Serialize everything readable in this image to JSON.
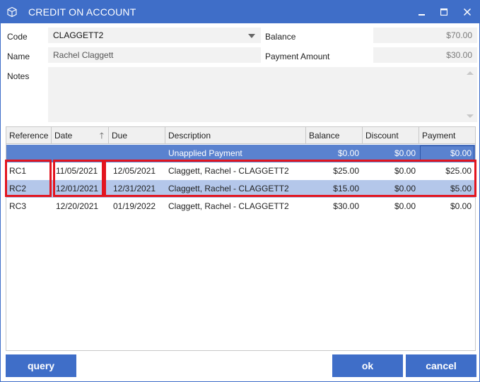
{
  "window": {
    "title": "CREDIT ON ACCOUNT",
    "controls": {
      "minimize": "▁",
      "maximize": "□",
      "close": "✕"
    }
  },
  "form": {
    "code_label": "Code",
    "code_value": "CLAGGETT2",
    "name_label": "Name",
    "name_value": "Rachel Claggett",
    "notes_label": "Notes",
    "notes_value": "",
    "balance_label": "Balance",
    "balance_value": "$70.00",
    "payment_amount_label": "Payment Amount",
    "payment_amount_value": "$30.00"
  },
  "grid": {
    "columns": [
      "Reference",
      "Date",
      "Due",
      "Description",
      "Balance",
      "Discount",
      "Payment"
    ],
    "sorted_column": "Date",
    "sort_direction": "ascending",
    "summary": {
      "description": "Unapplied Payment",
      "balance": "$0.00",
      "discount": "$0.00",
      "payment": "$0.00"
    },
    "rows": [
      {
        "reference": "RC1",
        "date": "11/05/2021",
        "due": "12/05/2021",
        "description": "Claggett, Rachel - CLAGGETT2",
        "balance": "$25.00",
        "discount": "$0.00",
        "payment": "$25.00"
      },
      {
        "reference": "RC2",
        "date": "12/01/2021",
        "due": "12/31/2021",
        "description": "Claggett, Rachel - CLAGGETT2",
        "balance": "$15.00",
        "discount": "$0.00",
        "payment": "$5.00"
      },
      {
        "reference": "RC3",
        "date": "12/20/2021",
        "due": "01/19/2022",
        "description": "Claggett, Rachel - CLAGGETT2",
        "balance": "$30.00",
        "discount": "$0.00",
        "payment": "$0.00"
      }
    ],
    "selected_row_index": 1,
    "highlight_color": "#e3151f"
  },
  "buttons": {
    "query": "query",
    "ok": "ok",
    "cancel": "cancel"
  },
  "colors": {
    "accent": "#3f6ec8",
    "summary_row": "#5a82cf",
    "selected_row": "#b4c7ea",
    "field_bg": "#f2f2f2"
  }
}
